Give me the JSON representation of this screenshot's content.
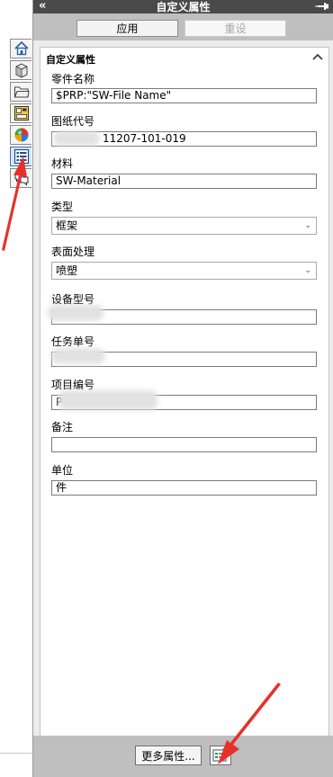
{
  "title": "自定义属性",
  "toolbar": {
    "apply_label": "应用",
    "reset_label": "重设"
  },
  "group": {
    "header": "自定义属性"
  },
  "fields": [
    {
      "label": "零件名称",
      "value": "$PRP:\"SW-File Name\""
    },
    {
      "label": "图纸代号",
      "value": "11207-101-019"
    },
    {
      "label": "材料",
      "value": "SW-Material"
    },
    {
      "label": "类型",
      "value": "框架"
    },
    {
      "label": "表面处理",
      "value": "喷塑"
    },
    {
      "label": "设备型号",
      "value": ""
    },
    {
      "label": "任务单号",
      "value": ""
    },
    {
      "label": "项目编号",
      "value": "P"
    },
    {
      "label": "备注",
      "value": ""
    },
    {
      "label": "单位",
      "value": "件"
    }
  ],
  "footer": {
    "more_label": "更多属性..."
  },
  "icons": {
    "collapse": "double-chevron-left-icon",
    "pin": "pin-icon",
    "group_toggle": "chevron-up-icon",
    "tabs": [
      "home-icon",
      "design-library-icon",
      "folder-icon",
      "view-palette-icon",
      "appearance-icon",
      "custom-properties-icon",
      "forum-icon"
    ]
  },
  "colors": {
    "title_bar": "#4a4a4a",
    "toolbar": "#bfbfbf",
    "annotation_arrow": "#e8302a",
    "active_tab": "#d9e7f7"
  }
}
